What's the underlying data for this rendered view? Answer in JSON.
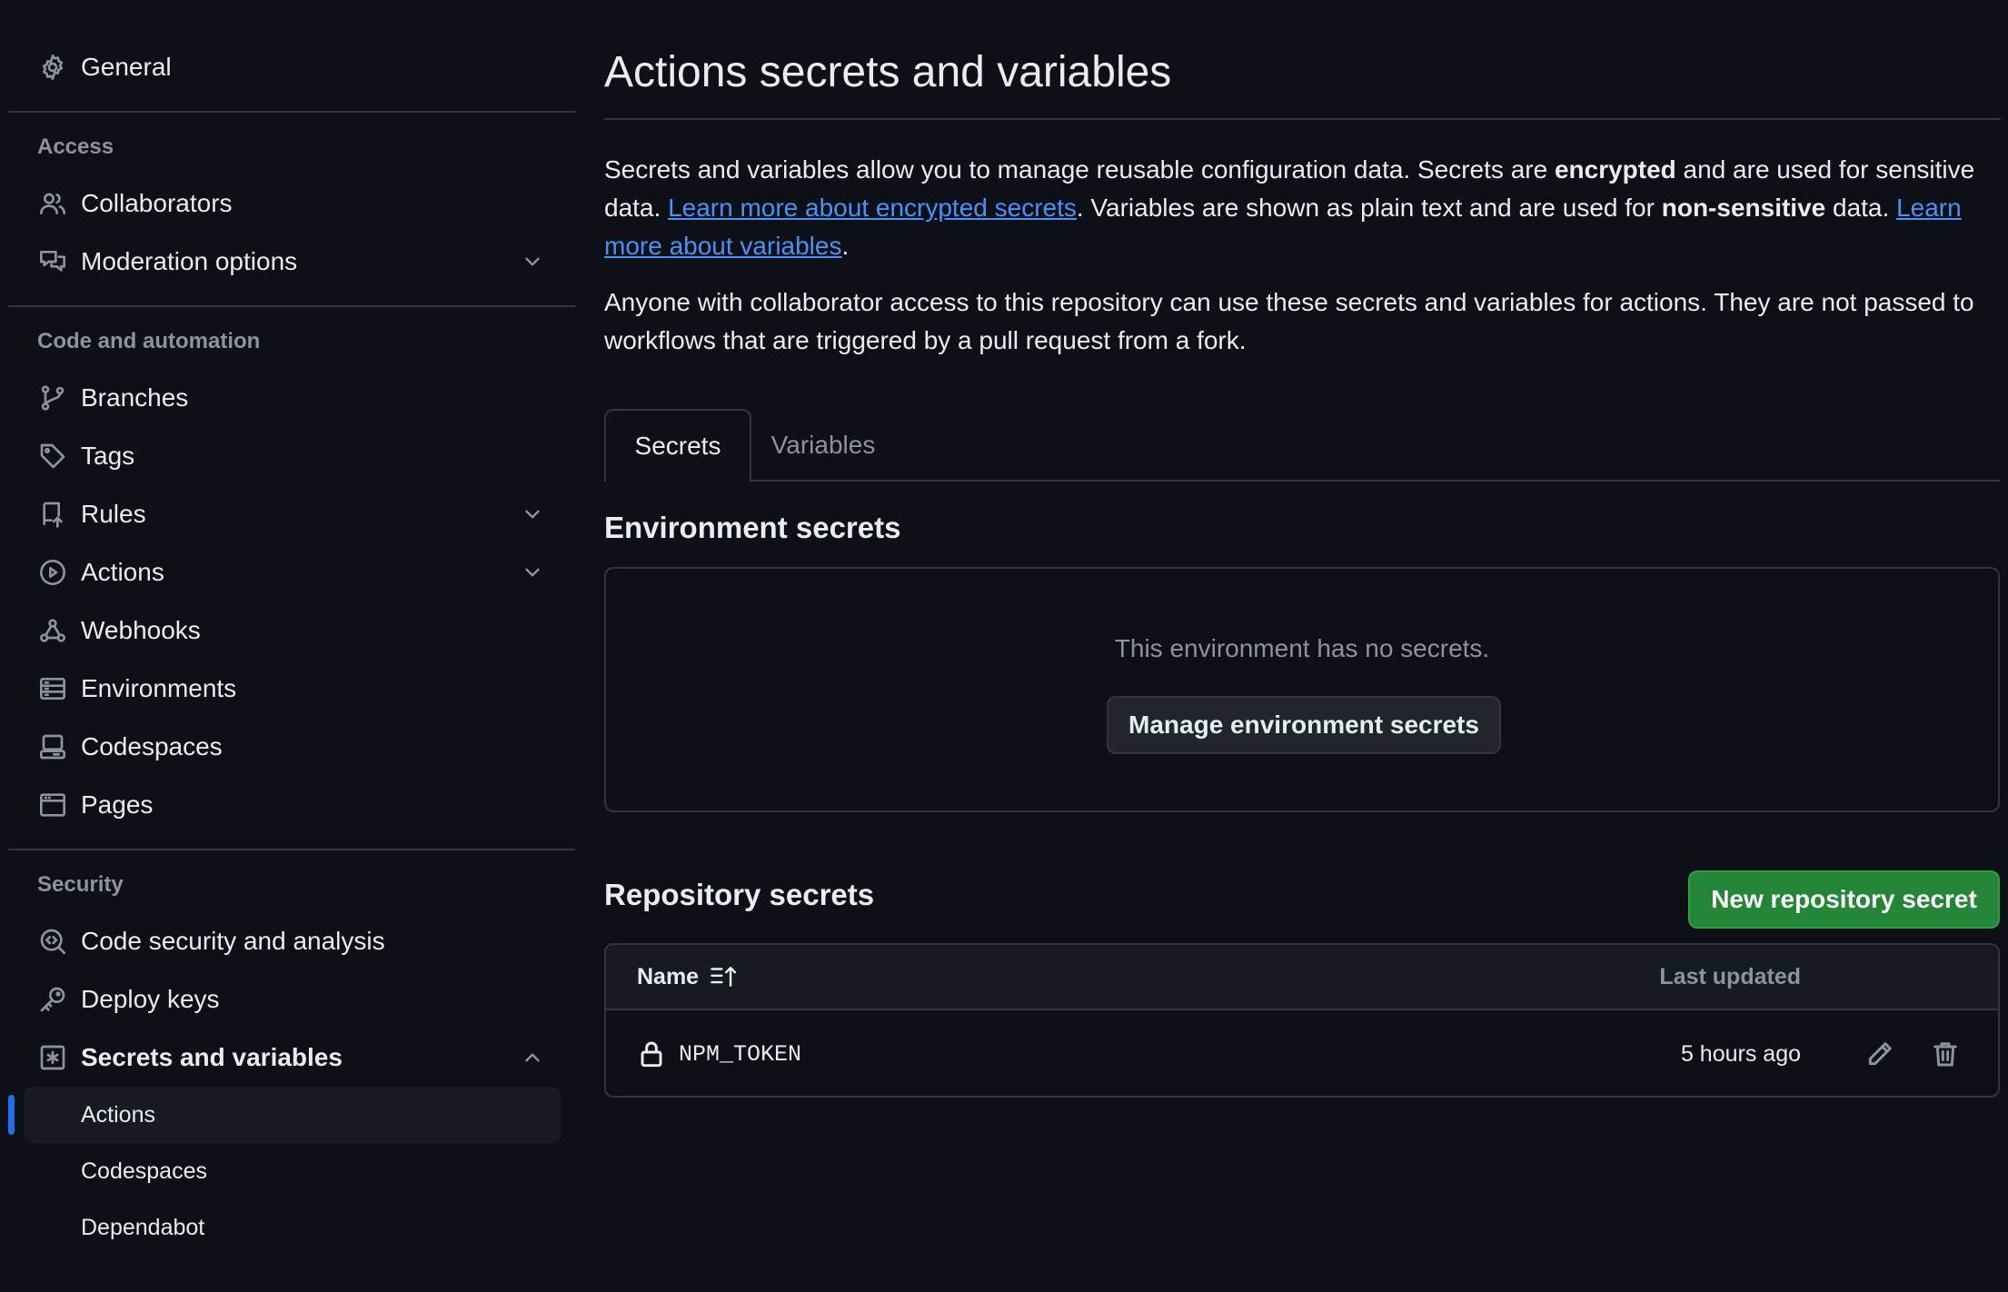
{
  "sidebar": {
    "general": "General",
    "sections": {
      "access": {
        "heading": "Access",
        "items": [
          "Collaborators",
          "Moderation options"
        ]
      },
      "code": {
        "heading": "Code and automation",
        "items": [
          "Branches",
          "Tags",
          "Rules",
          "Actions",
          "Webhooks",
          "Environments",
          "Codespaces",
          "Pages"
        ]
      },
      "security": {
        "heading": "Security",
        "items": [
          "Code security and analysis",
          "Deploy keys",
          "Secrets and variables"
        ],
        "sub_items": [
          "Actions",
          "Codespaces",
          "Dependabot"
        ]
      }
    }
  },
  "main": {
    "title": "Actions secrets and variables",
    "intro": {
      "p1_a": "Secrets and variables allow you to manage reusable configuration data. Secrets are ",
      "p1_b": "encrypted",
      "p1_c": " and are used for sensitive data. ",
      "p1_link1": "Learn more about encrypted secrets",
      "p1_d": ". Variables are shown as plain text and are used for ",
      "p1_e": "non-sensitive",
      "p1_f": " data. ",
      "p1_link2": "Learn more about variables",
      "p1_g": ".",
      "p2": "Anyone with collaborator access to this repository can use these secrets and variables for actions. They are not passed to workflows that are triggered by a pull request from a fork."
    },
    "tabs": [
      "Secrets",
      "Variables"
    ],
    "environment": {
      "title": "Environment secrets",
      "empty": "This environment has no secrets.",
      "button": "Manage environment secrets"
    },
    "repository": {
      "title": "Repository secrets",
      "new_button": "New repository secret",
      "columns": {
        "name": "Name",
        "updated": "Last updated"
      },
      "rows": [
        {
          "name": "NPM_TOKEN",
          "updated": "5 hours ago"
        }
      ]
    }
  },
  "colors": {
    "background": "#0d1117",
    "link": "#4493f8",
    "primary_button": "#238636",
    "active_indicator": "#1f6feb"
  },
  "icons": {
    "general": "gear-icon",
    "collaborators": "people-icon",
    "moderation": "comment-discussion-icon",
    "branches": "git-branch-icon",
    "tags": "tag-icon",
    "rules": "repo-push-icon",
    "actions": "play-icon",
    "webhooks": "webhook-icon",
    "environments": "server-icon",
    "codespaces": "codespaces-icon",
    "pages": "browser-icon",
    "code_security": "codescan-icon",
    "deploy_keys": "key-icon",
    "secrets": "key-asterisk-icon",
    "sort": "sort-asc-icon",
    "lock": "lock-icon",
    "edit": "pencil-icon",
    "delete": "trash-icon"
  }
}
